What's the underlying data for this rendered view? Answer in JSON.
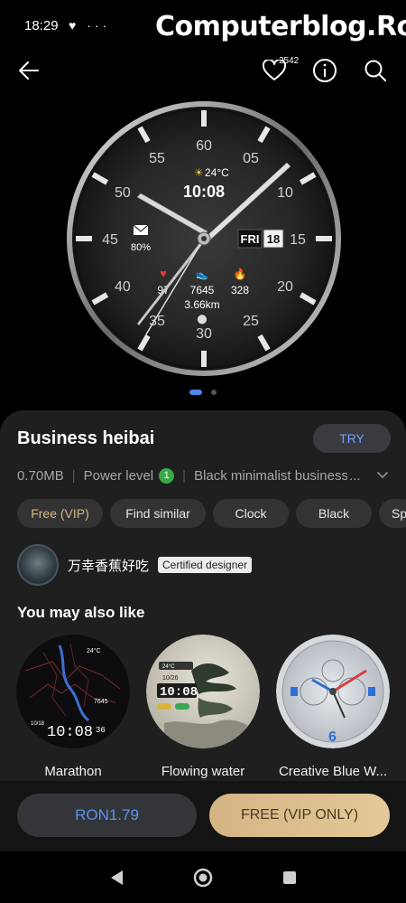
{
  "status_bar": {
    "time": "18:29",
    "icons": "♥ ···"
  },
  "watermark": "Computerblog.Ro",
  "top_bar": {
    "favorites_count": "2542"
  },
  "watch_face": {
    "ticks": [
      "60",
      "05",
      "10",
      "15",
      "20",
      "25",
      "30",
      "35",
      "40",
      "45",
      "50",
      "55"
    ],
    "weather": "24°C",
    "time": "10:08",
    "battery": "80%",
    "day": "FRI",
    "date": "18",
    "heart_rate": "97",
    "steps": "7645",
    "calories": "328",
    "distance": "3.66km"
  },
  "pagination": {
    "pages": 2,
    "active": 1
  },
  "details": {
    "title": "Business heibai",
    "try_label": "TRY",
    "size": "0.70MB",
    "power_label": "Power level",
    "power_value": "1",
    "description": "Black minimalist business",
    "ellipsis": "..."
  },
  "tags": [
    "Free (VIP)",
    "Find similar",
    "Clock",
    "Black",
    "Sport"
  ],
  "designer": {
    "name": "万幸香蕉好吃",
    "badge": "Certified designer"
  },
  "recommendations": {
    "section_title": "You may also like",
    "items": [
      {
        "label": "Marathon",
        "time": "10:08",
        "seconds": "36",
        "weather": "24°C",
        "steps": "7645",
        "date": "10/18"
      },
      {
        "label": "Flowing water",
        "time": "10:08",
        "date": "10/26",
        "weather": "24°C"
      },
      {
        "label": "Creative Blue W...",
        "numeral": "6"
      }
    ]
  },
  "actions": {
    "price": "RON1.79",
    "free": "FREE (VIP ONLY)"
  },
  "colors": {
    "accent_blue": "#5b93ee",
    "gold": "#d5b483",
    "sheet_bg": "#1f1f1f",
    "power_green": "#3ba84a"
  }
}
